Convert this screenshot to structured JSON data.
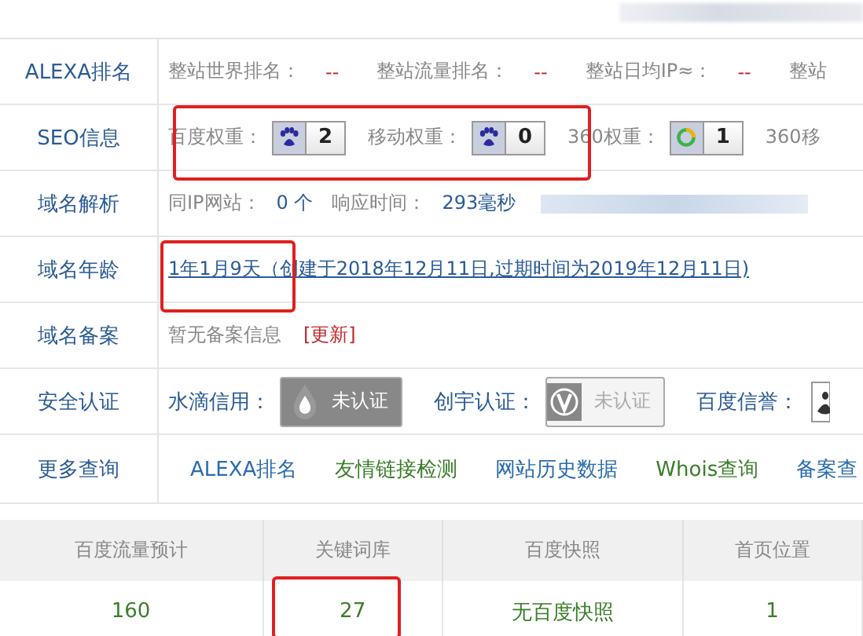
{
  "rows": [
    {
      "label": "ALEXA排名",
      "kind": "stats",
      "items": [
        {
          "name": "整站世界排名：",
          "value": "--"
        },
        {
          "name": "整站流量排名：",
          "value": "--"
        },
        {
          "name": "整站日均IP≈：",
          "value": "--"
        },
        {
          "name": "整站"
        }
      ]
    },
    {
      "label": "SEO信息",
      "kind": "weights",
      "items": [
        {
          "name": "百度权重：",
          "value": "2"
        },
        {
          "name": "移动权重：",
          "value": "0"
        },
        {
          "name": "360权重：",
          "value": "1"
        },
        {
          "name": "360移"
        }
      ]
    },
    {
      "label": "域名解析",
      "kind": "dns",
      "items": [
        {
          "name": "同IP网站：",
          "value": "0 个"
        },
        {
          "name": "响应时间：",
          "value": "293毫秒"
        }
      ]
    },
    {
      "label": "域名年龄",
      "kind": "age",
      "link": "1年1月9天（创建于2018年12月11日,过期时间为2019年12月11日)"
    },
    {
      "label": "域名备案",
      "kind": "icp",
      "text": "暂无备案信息",
      "action": "[更新]"
    },
    {
      "label": "安全认证",
      "kind": "certs",
      "items": [
        {
          "name": "水滴信用：",
          "status": "未认证"
        },
        {
          "name": "创宇认证：",
          "status": "未认证"
        },
        {
          "name": "百度信誉："
        }
      ]
    },
    {
      "label": "更多查询",
      "kind": "links",
      "items": [
        {
          "text": "ALEXA排名",
          "color": "#2a6cb0"
        },
        {
          "text": "友情链接检测",
          "color": "#3a7d2a"
        },
        {
          "text": "网站历史数据",
          "color": "#2a6cb0"
        },
        {
          "text": "Whois查询",
          "color": "#3a7d2a"
        },
        {
          "text": "备案查"
        }
      ]
    }
  ],
  "table": {
    "columns": [
      "百度流量预计",
      "关键词库",
      "百度快照",
      "首页位置"
    ],
    "rows": [
      [
        "160",
        "27",
        "无百度快照",
        "1"
      ]
    ]
  }
}
